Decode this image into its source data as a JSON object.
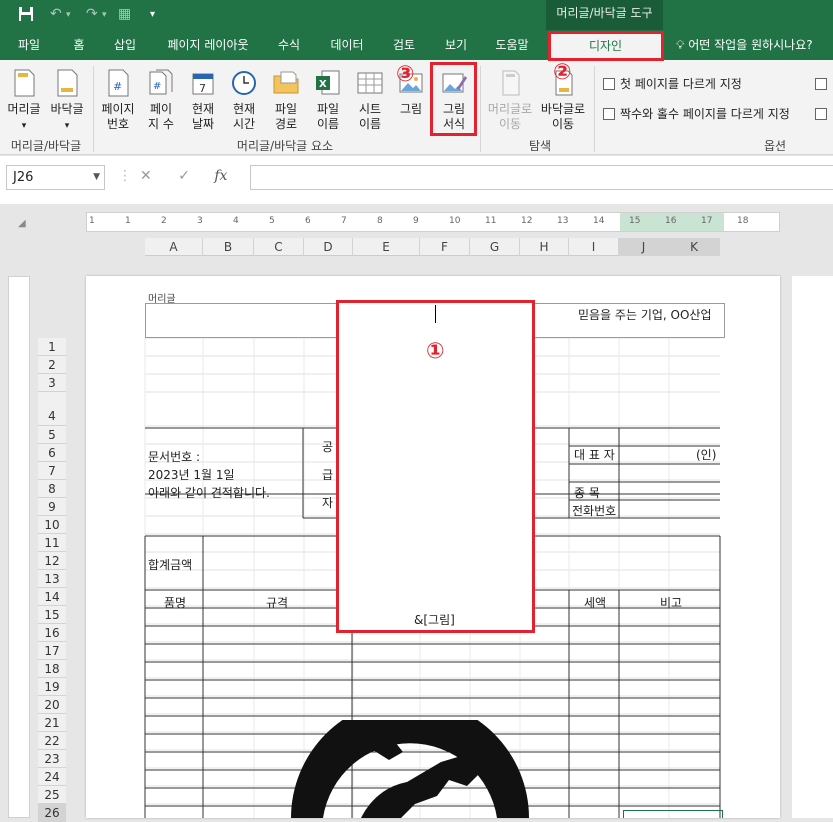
{
  "titlebar": {
    "context_tool": "머리글/바닥글 도구"
  },
  "tabs": [
    "파일",
    "홈",
    "삽입",
    "페이지 레이아웃",
    "수식",
    "데이터",
    "검토",
    "보기",
    "도움말",
    "디자인"
  ],
  "tell_me": "어떤 작업을 원하시나요?",
  "ribbon": {
    "btn_header": "머리글",
    "btn_footer": "바닥글",
    "btn_page_number": [
      "페이지",
      "번호"
    ],
    "btn_page_count": [
      "페이",
      "지 수"
    ],
    "btn_current_date": [
      "현재",
      "날짜"
    ],
    "btn_current_time": [
      "현재",
      "시간"
    ],
    "btn_file_path": [
      "파일",
      "경로"
    ],
    "btn_file_name": [
      "파일",
      "이름"
    ],
    "btn_sheet_name": [
      "시트",
      "이름"
    ],
    "btn_picture": "그림",
    "btn_format_picture": [
      "그림",
      "서식"
    ],
    "btn_goto_header": [
      "머리글로",
      "이동"
    ],
    "btn_goto_footer": [
      "바닥글로",
      "이동"
    ],
    "grp_header_footer": "머리글/바닥글",
    "grp_elements": "머리글/바닥글 요소",
    "grp_navigation": "탐색",
    "grp_options": "옵션",
    "opt_first_page": "첫 페이지를 다르게 지정",
    "opt_odd_even": "짝수와 홀수 페이지를 다르게 지정"
  },
  "formula_bar": {
    "name_box": "J26",
    "fx": "fx",
    "cancel": "✕",
    "enter": "✓"
  },
  "ruler_numbers": [
    "1",
    "1",
    "2",
    "3",
    "4",
    "5",
    "6",
    "7",
    "8",
    "9",
    "10",
    "11",
    "12",
    "13",
    "14",
    "15",
    "16",
    "17",
    "18",
    "19"
  ],
  "columns": [
    "A",
    "B",
    "C",
    "D",
    "E",
    "F",
    "G",
    "H",
    "I",
    "J",
    "K"
  ],
  "rows": [
    "1",
    "2",
    "3",
    "4",
    "5",
    "6",
    "7",
    "8",
    "9",
    "10",
    "11",
    "12",
    "13",
    "14",
    "15",
    "16",
    "17",
    "18",
    "19",
    "20",
    "21",
    "22",
    "23",
    "24",
    "25",
    "26"
  ],
  "sheet": {
    "header_area_label": "머리글",
    "header_right_text": "믿음을 주는 기업, OO산업",
    "doc_number": "문서번호 :",
    "date": "2023년 1월 1일",
    "intro": "아래와 같이 견적합니다.",
    "vertical_label": [
      "공",
      "급",
      "자"
    ],
    "ceo": "대 표 자",
    "seal": "(인)",
    "category": "종      목",
    "phone": "전화번호",
    "total": "합계금액",
    "col_item": "품명",
    "col_spec": "규격",
    "col_tax": "세액",
    "col_note": "비고",
    "picture_code": "&[그림]"
  },
  "annotations": {
    "step1": "①",
    "step2": "②",
    "step3": "③"
  },
  "colors": {
    "excel_green": "#217346",
    "annotation_red": "#e3222f"
  }
}
